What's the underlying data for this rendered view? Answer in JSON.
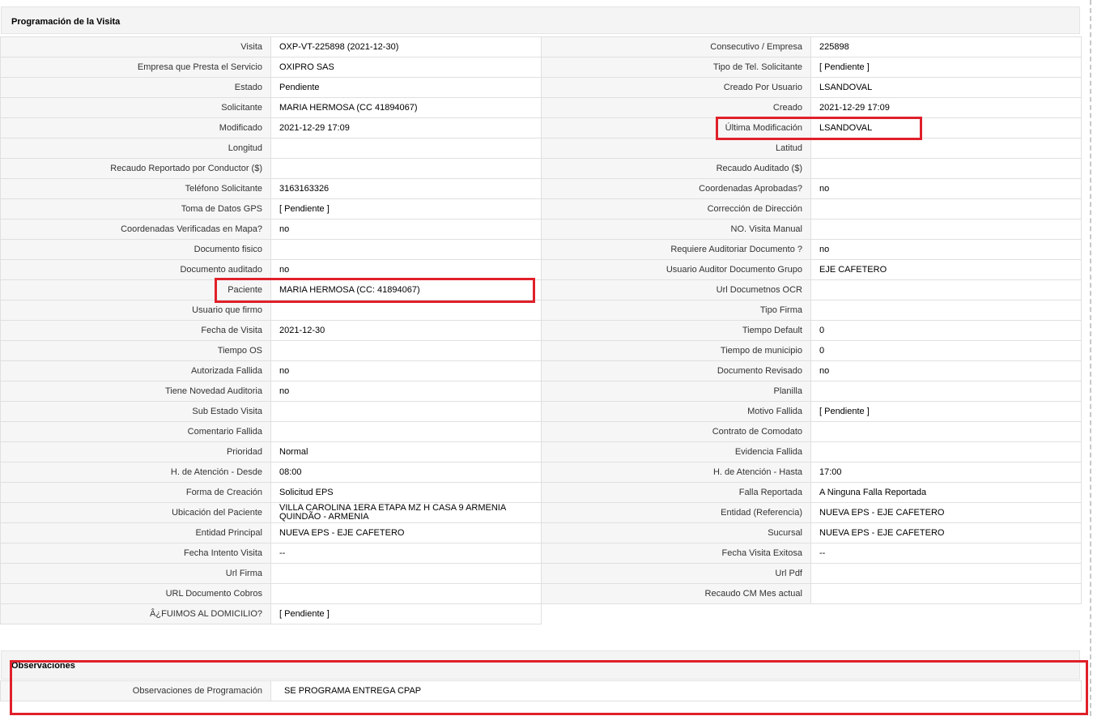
{
  "section_title": "Programación de la Visita",
  "left_rows": [
    {
      "label": "Visita",
      "value": "OXP-VT-225898 (2021-12-30)"
    },
    {
      "label": "Empresa que Presta el Servicio",
      "value": "OXIPRO SAS"
    },
    {
      "label": "Estado",
      "value": "Pendiente"
    },
    {
      "label": "Solicitante",
      "value": "MARIA HERMOSA (CC 41894067)"
    },
    {
      "label": "Modificado",
      "value": "2021-12-29 17:09"
    },
    {
      "label": "Longitud",
      "value": ""
    },
    {
      "label": "Recaudo Reportado por Conductor ($)",
      "value": ""
    },
    {
      "label": "Teléfono Solicitante",
      "value": "3163163326"
    },
    {
      "label": "Toma de Datos GPS",
      "value": "[ Pendiente ]"
    },
    {
      "label": "Coordenadas Verificadas en Mapa?",
      "value": " no"
    },
    {
      "label": "Documento fisico",
      "value": ""
    },
    {
      "label": "Documento auditado",
      "value": " no"
    },
    {
      "label": "Paciente",
      "value": "MARIA HERMOSA (CC: 41894067)"
    },
    {
      "label": "Usuario que firmo",
      "value": ""
    },
    {
      "label": "Fecha de Visita",
      "value": " 2021-12-30"
    },
    {
      "label": "Tiempo OS",
      "value": ""
    },
    {
      "label": "Autorizada Fallida",
      "value": " no"
    },
    {
      "label": "Tiene Novedad Auditoria",
      "value": " no"
    },
    {
      "label": "Sub Estado Visita",
      "value": ""
    },
    {
      "label": "Comentario Fallida",
      "value": ""
    },
    {
      "label": "Prioridad",
      "value": "Normal"
    },
    {
      "label": "H. de Atención - Desde",
      "value": "08:00"
    },
    {
      "label": "Forma de Creación",
      "value": "Solicitud EPS"
    },
    {
      "label": "Ubicación del Paciente",
      "value": "VILLA CAROLINA 1ERA ETAPA MZ H CASA 9 ARMENIA QUINDÃ­O - ARMENIA"
    },
    {
      "label": "Entidad Principal",
      "value": "NUEVA EPS - EJE CAFETERO"
    },
    {
      "label": "Fecha Intento Visita",
      "value": " --"
    },
    {
      "label": "Url Firma",
      "value": ""
    },
    {
      "label": "URL Documento Cobros",
      "value": ""
    },
    {
      "label": "Â¿FUIMOS AL DOMICILIO?",
      "value": "[ Pendiente ]"
    }
  ],
  "right_rows": [
    {
      "label": "Consecutivo / Empresa",
      "value": "225898"
    },
    {
      "label": "Tipo de Tel. Solicitante",
      "value": "[ Pendiente ]"
    },
    {
      "label": "Creado Por Usuario",
      "value": "LSANDOVAL"
    },
    {
      "label": "Creado",
      "value": "2021-12-29 17:09"
    },
    {
      "label": "Última Modificación",
      "value": " LSANDOVAL"
    },
    {
      "label": "Latitud",
      "value": ""
    },
    {
      "label": "Recaudo Auditado ($)",
      "value": ""
    },
    {
      "label": "Coordenadas Aprobadas?",
      "value": " no"
    },
    {
      "label": "Corrección de Dirección",
      "value": ""
    },
    {
      "label": "NO. Visita Manual",
      "value": ""
    },
    {
      "label": "Requiere Auditoriar Documento ?",
      "value": " no"
    },
    {
      "label": "Usuario Auditor Documento Grupo",
      "value": "EJE CAFETERO"
    },
    {
      "label": "Url Documetnos OCR",
      "value": ""
    },
    {
      "label": "Tipo Firma",
      "value": ""
    },
    {
      "label": "Tiempo Default",
      "value": "0"
    },
    {
      "label": "Tiempo de municipio",
      "value": "0"
    },
    {
      "label": "Documento Revisado",
      "value": " no"
    },
    {
      "label": "Planilla",
      "value": ""
    },
    {
      "label": "Motivo Fallida",
      "value": "[ Pendiente ]"
    },
    {
      "label": "Contrato de Comodato",
      "value": ""
    },
    {
      "label": "Evidencia Fallida",
      "value": ""
    },
    {
      "label": "H. de Atención - Hasta",
      "value": " 17:00"
    },
    {
      "label": "Falla Reportada",
      "value": "A Ninguna Falla Reportada"
    },
    {
      "label": "Entidad (Referencia)",
      "value": "NUEVA EPS - EJE CAFETERO"
    },
    {
      "label": "Sucursal",
      "value": "NUEVA EPS - EJE CAFETERO"
    },
    {
      "label": "Fecha Visita Exitosa",
      "value": " --"
    },
    {
      "label": "Url Pdf",
      "value": ""
    },
    {
      "label": "Recaudo CM Mes actual",
      "value": ""
    }
  ],
  "observaciones": {
    "title": "Observaciones",
    "label": "Observaciones de Programación",
    "value": " SE PROGRAMA ENTREGA CPAP"
  },
  "highlight_color": "#e0202a"
}
